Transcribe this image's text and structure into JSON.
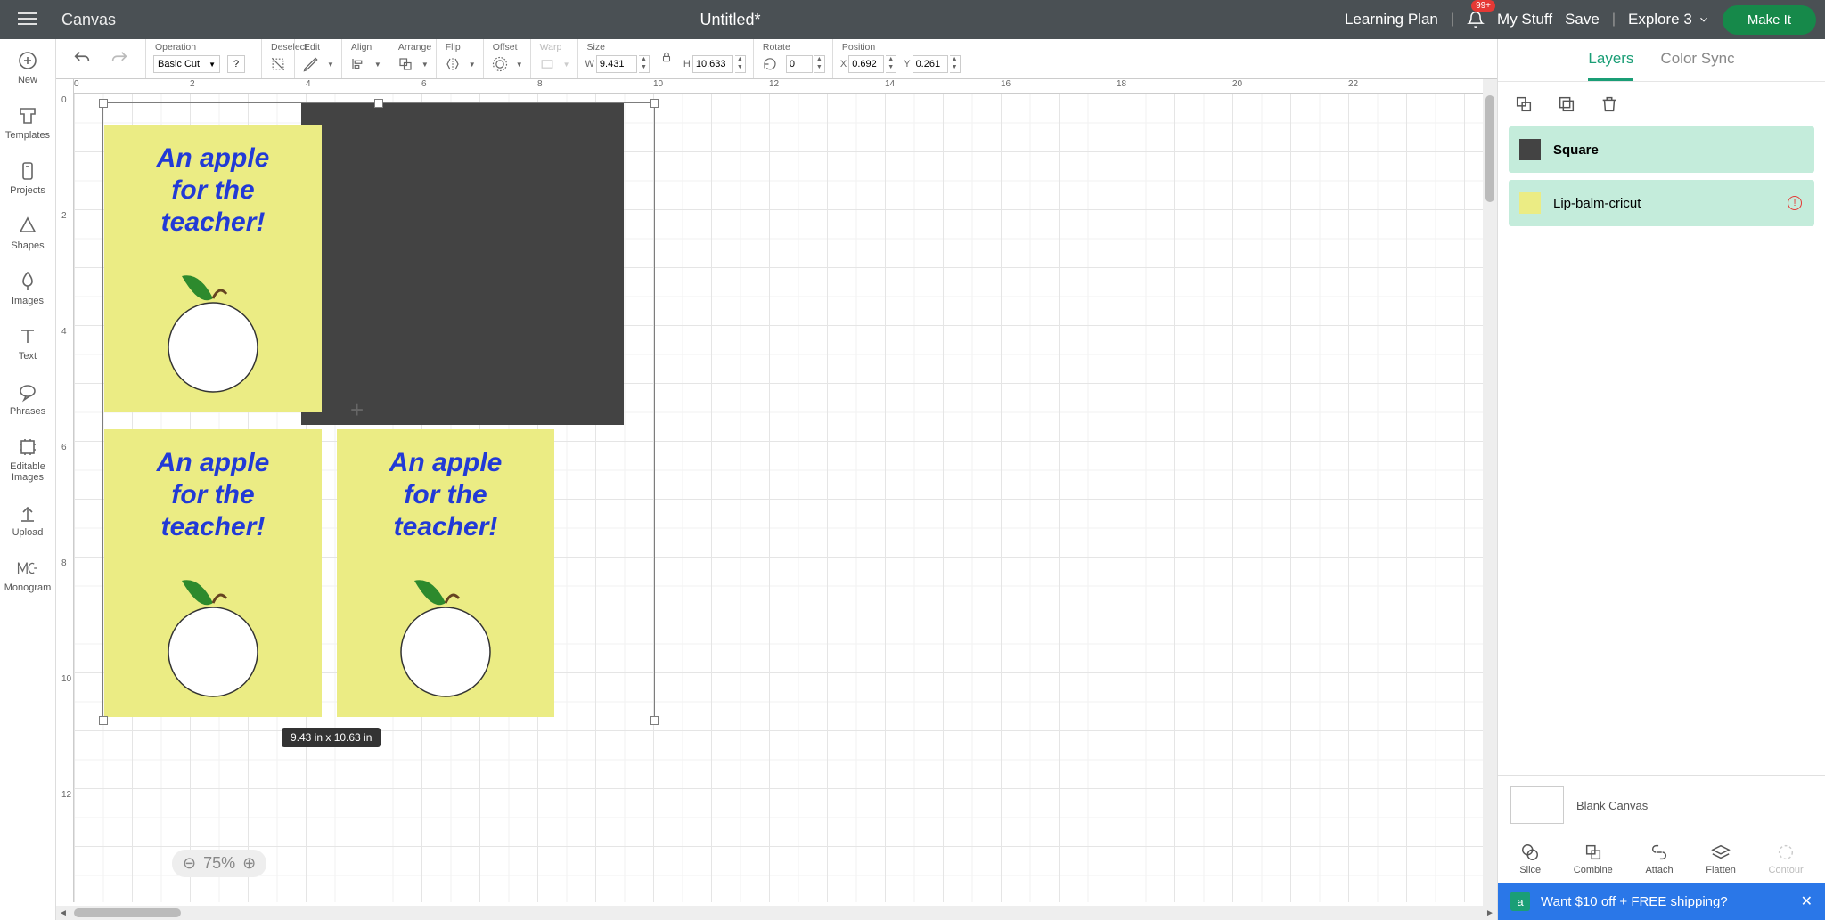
{
  "header": {
    "canvas_label": "Canvas",
    "title": "Untitled*",
    "learning_plan": "Learning Plan",
    "notification_badge": "99+",
    "my_stuff": "My Stuff",
    "save": "Save",
    "machine": "Explore 3",
    "make_it": "Make It"
  },
  "leftnav": {
    "new": "New",
    "templates": "Templates",
    "projects": "Projects",
    "shapes": "Shapes",
    "images": "Images",
    "text": "Text",
    "phrases": "Phrases",
    "editable": "Editable Images",
    "upload": "Upload",
    "monogram": "Monogram"
  },
  "toolbar": {
    "operation_label": "Operation",
    "operation_value": "Basic Cut",
    "deselect": "Deselect",
    "edit": "Edit",
    "align": "Align",
    "arrange": "Arrange",
    "flip": "Flip",
    "offset": "Offset",
    "warp": "Warp",
    "size": "Size",
    "size_w": "9.431",
    "size_h": "10.633",
    "rotate": "Rotate",
    "rotate_val": "0",
    "position": "Position",
    "pos_x": "0.692",
    "pos_y": "0.261"
  },
  "ruler_h": [
    "0",
    "2",
    "4",
    "6",
    "8",
    "10",
    "12",
    "14",
    "16",
    "18",
    "20",
    "22"
  ],
  "ruler_v": [
    "0",
    "2",
    "4",
    "6",
    "8",
    "10",
    "12"
  ],
  "canvas": {
    "card_text_l1": "An apple",
    "card_text_l2": "for the",
    "card_text_l3": "teacher!",
    "selection_dims": "9.43  in x 10.63  in"
  },
  "zoom": "75%",
  "rightpanel": {
    "tab_layers": "Layers",
    "tab_colorsync": "Color Sync",
    "layer1": "Square",
    "layer2": "Lip-balm-cricut",
    "blank_canvas": "Blank Canvas",
    "tools": {
      "slice": "Slice",
      "combine": "Combine",
      "attach": "Attach",
      "flatten": "Flatten",
      "contour": "Contour"
    },
    "promo_text": "Want $10 off + FREE shipping?"
  }
}
